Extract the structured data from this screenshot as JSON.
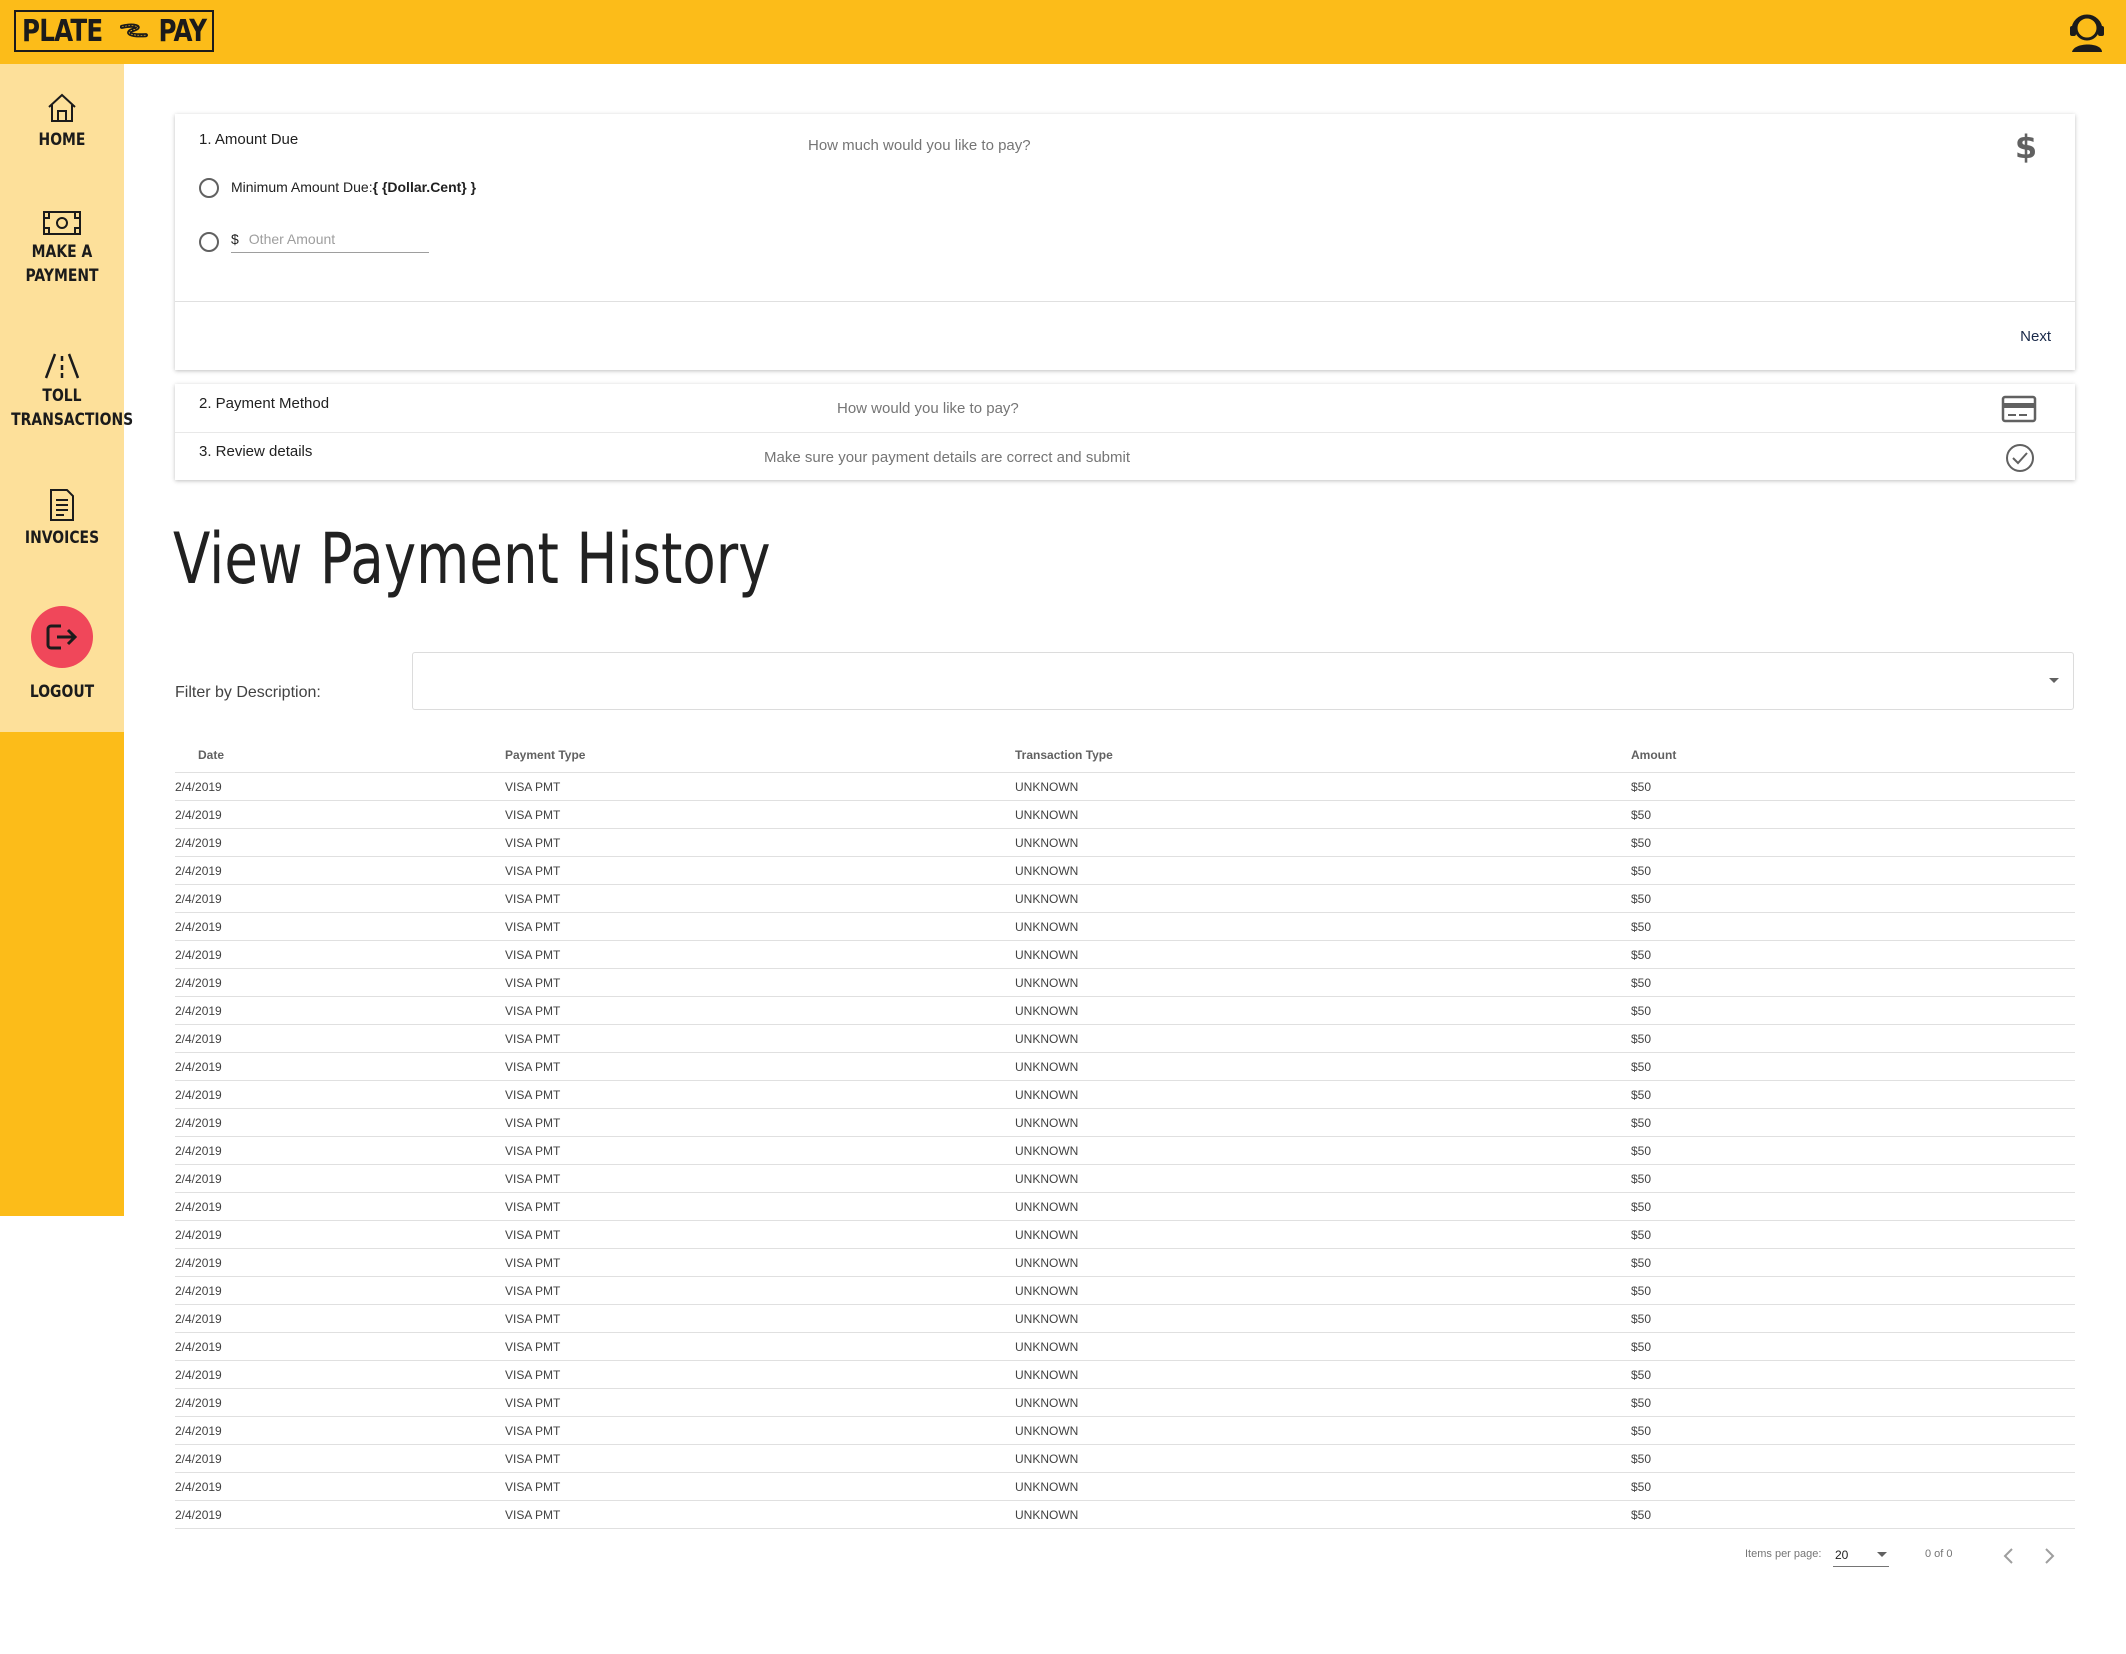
{
  "header": {
    "logo_left": "PLATE",
    "logo_right": "PAY",
    "brand_color": "#FCBC19",
    "support_icon": "customer-support-icon"
  },
  "sidebar": {
    "items": [
      {
        "label": "HOME",
        "icon": "home-icon"
      },
      {
        "label": "MAKE A",
        "label2": "PAYMENT",
        "icon": "money-icon"
      },
      {
        "label": "TOLL",
        "label2": "TRANSACTIONS",
        "icon": "road-icon"
      },
      {
        "label": "INVOICES",
        "icon": "invoice-icon"
      },
      {
        "label": "LOGOUT",
        "icon": "logout-icon",
        "accent": "#F0475A"
      }
    ]
  },
  "stepper": {
    "step1": {
      "title": "1. Amount Due",
      "description": "How much would you like to pay?",
      "icon": "dollar-icon",
      "min_label": "Minimum Amount Due:",
      "min_value": "{ {Dollar.Cent} }",
      "other_prefix": "$",
      "other_placeholder": "Other Amount",
      "next_label": "Next"
    },
    "step2": {
      "title": "2. Payment Method",
      "description": "How would you like to pay?",
      "icon": "credit-card-icon"
    },
    "step3": {
      "title": "3. Review details",
      "description": "Make sure your payment details are correct and submit",
      "icon": "check-circle-icon"
    }
  },
  "history": {
    "heading": "View Payment History",
    "filter_label": "Filter by Description:",
    "filter_value": "",
    "columns": [
      "Date",
      "Payment Type",
      "Transaction Type",
      "Amount"
    ],
    "rows": [
      [
        "2/4/2019",
        "VISA PMT",
        "UNKNOWN",
        "$50"
      ],
      [
        "2/4/2019",
        "VISA PMT",
        "UNKNOWN",
        "$50"
      ],
      [
        "2/4/2019",
        "VISA PMT",
        "UNKNOWN",
        "$50"
      ],
      [
        "2/4/2019",
        "VISA PMT",
        "UNKNOWN",
        "$50"
      ],
      [
        "2/4/2019",
        "VISA PMT",
        "UNKNOWN",
        "$50"
      ],
      [
        "2/4/2019",
        "VISA PMT",
        "UNKNOWN",
        "$50"
      ],
      [
        "2/4/2019",
        "VISA PMT",
        "UNKNOWN",
        "$50"
      ],
      [
        "2/4/2019",
        "VISA PMT",
        "UNKNOWN",
        "$50"
      ],
      [
        "2/4/2019",
        "VISA PMT",
        "UNKNOWN",
        "$50"
      ],
      [
        "2/4/2019",
        "VISA PMT",
        "UNKNOWN",
        "$50"
      ],
      [
        "2/4/2019",
        "VISA PMT",
        "UNKNOWN",
        "$50"
      ],
      [
        "2/4/2019",
        "VISA PMT",
        "UNKNOWN",
        "$50"
      ],
      [
        "2/4/2019",
        "VISA PMT",
        "UNKNOWN",
        "$50"
      ],
      [
        "2/4/2019",
        "VISA PMT",
        "UNKNOWN",
        "$50"
      ],
      [
        "2/4/2019",
        "VISA PMT",
        "UNKNOWN",
        "$50"
      ],
      [
        "2/4/2019",
        "VISA PMT",
        "UNKNOWN",
        "$50"
      ],
      [
        "2/4/2019",
        "VISA PMT",
        "UNKNOWN",
        "$50"
      ],
      [
        "2/4/2019",
        "VISA PMT",
        "UNKNOWN",
        "$50"
      ],
      [
        "2/4/2019",
        "VISA PMT",
        "UNKNOWN",
        "$50"
      ],
      [
        "2/4/2019",
        "VISA PMT",
        "UNKNOWN",
        "$50"
      ],
      [
        "2/4/2019",
        "VISA PMT",
        "UNKNOWN",
        "$50"
      ],
      [
        "2/4/2019",
        "VISA PMT",
        "UNKNOWN",
        "$50"
      ],
      [
        "2/4/2019",
        "VISA PMT",
        "UNKNOWN",
        "$50"
      ],
      [
        "2/4/2019",
        "VISA PMT",
        "UNKNOWN",
        "$50"
      ],
      [
        "2/4/2019",
        "VISA PMT",
        "UNKNOWN",
        "$50"
      ],
      [
        "2/4/2019",
        "VISA PMT",
        "UNKNOWN",
        "$50"
      ],
      [
        "2/4/2019",
        "VISA PMT",
        "UNKNOWN",
        "$50"
      ]
    ]
  },
  "paginator": {
    "items_per_page_label": "Items per page:",
    "items_per_page": "20",
    "range": "0 of 0",
    "prev_icon": "chevron-left-icon",
    "next_icon": "chevron-right-icon"
  }
}
